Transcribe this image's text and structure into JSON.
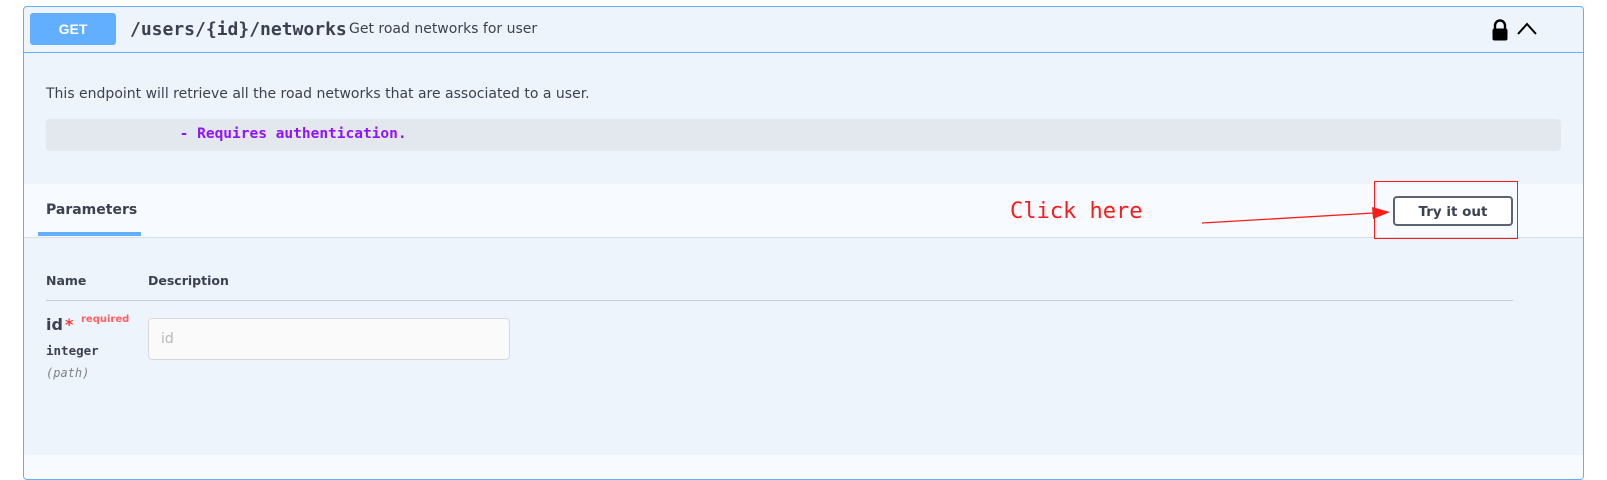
{
  "operation": {
    "method": "GET",
    "path": "/users/{id}/networks",
    "summary": "Get road networks for user"
  },
  "body": {
    "description": "This endpoint will retrieve all the road networks that are associated to a user.",
    "auth_note": "     - Requires authentication."
  },
  "parameters": {
    "tab_label": "Parameters",
    "try_button_label": "Try it out",
    "annotation_label": "Click here",
    "col_name": "Name",
    "col_description": "Description",
    "rows": [
      {
        "name": "id",
        "star": "*",
        "required_label": "required",
        "type": "integer",
        "in": "(path)",
        "placeholder": "id"
      }
    ]
  },
  "colors": {
    "get_accent": "#61affe",
    "annotation": "#ff1a1a",
    "auth_text": "#9012fe"
  },
  "icons": {
    "lock": "lock-icon",
    "collapse": "chevron-up-icon"
  }
}
